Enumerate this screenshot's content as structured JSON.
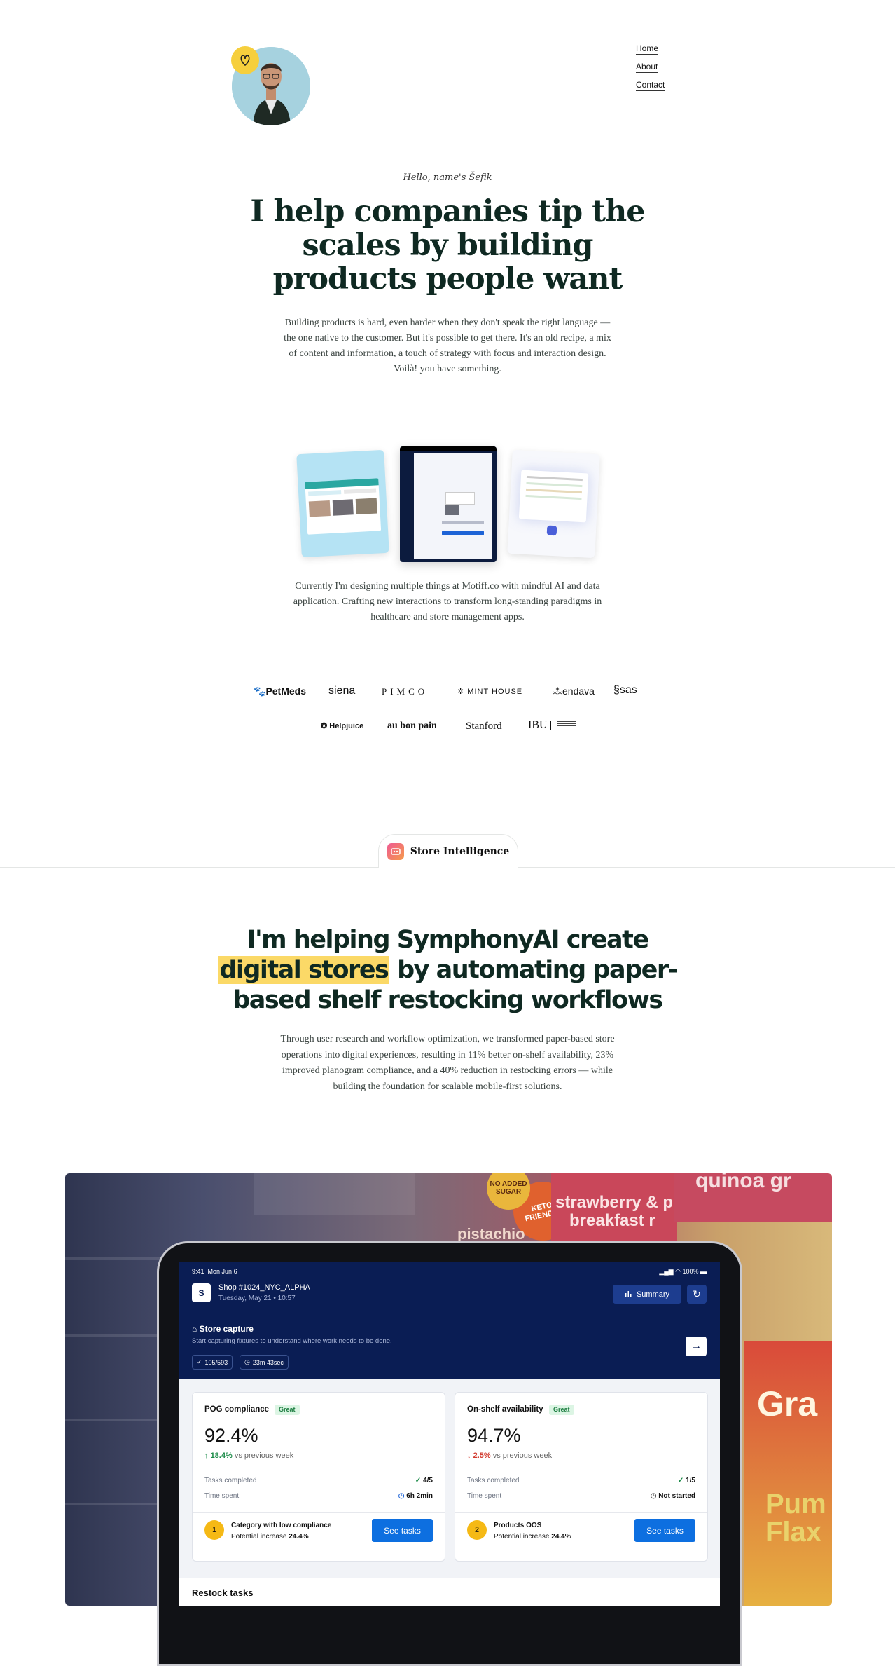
{
  "nav": {
    "home": "Home",
    "about": "About",
    "contact": "Contact"
  },
  "hero": {
    "greeting": "Hello, name's Šefik",
    "title": "I help companies tip the scales by building products people want",
    "subtitle": "Building products is hard, even harder when they don't speak the right language — the one native to the customer. But it's possible to get there. It's an old recipe, a mix of content and information, a touch of strategy with focus and interaction design. Voilà! you have something."
  },
  "current": "Currently I'm designing multiple things at Motiff.co with mindful AI and data application. Crafting new interactions to transform long-standing paradigms in healthcare and store management apps.",
  "logos": {
    "row1": [
      "PetMeds",
      "siena",
      "PIMCO",
      "MINT HOUSE",
      "endava",
      "sas"
    ],
    "row2": [
      "Helpjuice",
      "au bon pain",
      "Stanford",
      "IBU"
    ]
  },
  "section": {
    "tab_label": "Store Intelligence",
    "title_before": "I'm helping SymphonyAI create",
    "title_highlight": "digital stores",
    "title_after": "by automating paper-based shelf restocking workflows",
    "subtitle": "Through user research and workflow optimization, we transformed paper-based store operations into digital experiences, resulting in 11% better on-shelf availability, 23% improved planogram compliance, and a 40% reduction in restocking errors — while building the foundation for scalable mobile-first solutions."
  },
  "app": {
    "status_time": "9:41",
    "status_date": "Mon Jun 6",
    "battery": "100%",
    "store_initial": "S",
    "store_name": "Shop #1024_NYC_ALPHA",
    "store_date": "Tuesday, May 21 • 10:57",
    "summary_label": "Summary",
    "capture_title": "Store capture",
    "capture_desc": "Start capturing fixtures to understand where work needs to be done.",
    "chip_count": "105/593",
    "chip_time": "23m 43sec",
    "metrics": [
      {
        "title": "POG compliance",
        "badge": "Great",
        "value": "92.4%",
        "change": "18.4%",
        "direction": "up",
        "change_suffix": "vs previous week",
        "tasks_label": "Tasks completed",
        "tasks_value": "4/5",
        "time_label": "Time spent",
        "time_value": "6h 2min",
        "task_num": "1",
        "task_title": "Category with low compliance",
        "potential_label": "Potential increase",
        "potential_value": "24.4%",
        "button": "See tasks"
      },
      {
        "title": "On-shelf availability",
        "badge": "Great",
        "value": "94.7%",
        "change": "2.5%",
        "direction": "down",
        "change_suffix": "vs previous week",
        "tasks_label": "Tasks completed",
        "tasks_value": "1/5",
        "time_label": "Time spent",
        "time_value": "Not started",
        "task_num": "2",
        "task_title": "Products OOS",
        "potential_label": "Potential increase",
        "potential_value": "24.4%",
        "button": "See tasks"
      }
    ],
    "restock_title": "Restock tasks"
  },
  "photo_text": [
    "NO ADDED SUGAR",
    "KETO FRIENDLY",
    "strawberry & pis",
    "breakfast r",
    "quinoa gr",
    "pistachio",
    "Gra",
    "Pum",
    "Flax"
  ]
}
